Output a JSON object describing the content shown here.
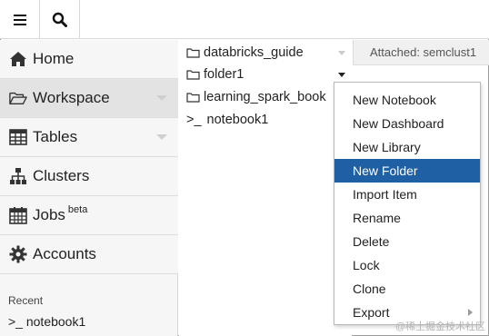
{
  "toolbar": {
    "menu_icon": "hamburger-icon",
    "search_icon": "search-icon"
  },
  "sidebar": {
    "items": [
      {
        "label": "Home",
        "icon": "home-icon"
      },
      {
        "label": "Workspace",
        "icon": "folder-open-icon"
      },
      {
        "label": "Tables",
        "icon": "table-icon"
      },
      {
        "label": "Clusters",
        "icon": "sitemap-icon"
      },
      {
        "label": "Jobs",
        "sup": "beta",
        "icon": "calendar-icon"
      },
      {
        "label": "Accounts",
        "icon": "gear-icon"
      }
    ],
    "recent_label": "Recent",
    "recent_items": [
      ">_ notebook1"
    ]
  },
  "files": {
    "items": [
      {
        "name": "databricks_guide",
        "type": "folder"
      },
      {
        "name": "folder1",
        "type": "folder"
      },
      {
        "name": "learning_spark_book",
        "type": "folder"
      },
      {
        "name": "notebook1",
        "type": "notebook",
        "prefix": ">_"
      }
    ]
  },
  "attached": {
    "text": "Attached: semclust1"
  },
  "context_menu": {
    "items": [
      "New Notebook",
      "New Dashboard",
      "New Library",
      "New Folder",
      "Import Item",
      "Rename",
      "Delete",
      "Lock",
      "Clone",
      "Export"
    ],
    "selected": "New Folder",
    "selected_color": "#1f5fa3"
  },
  "watermark": "@稀土掘金技术社区"
}
